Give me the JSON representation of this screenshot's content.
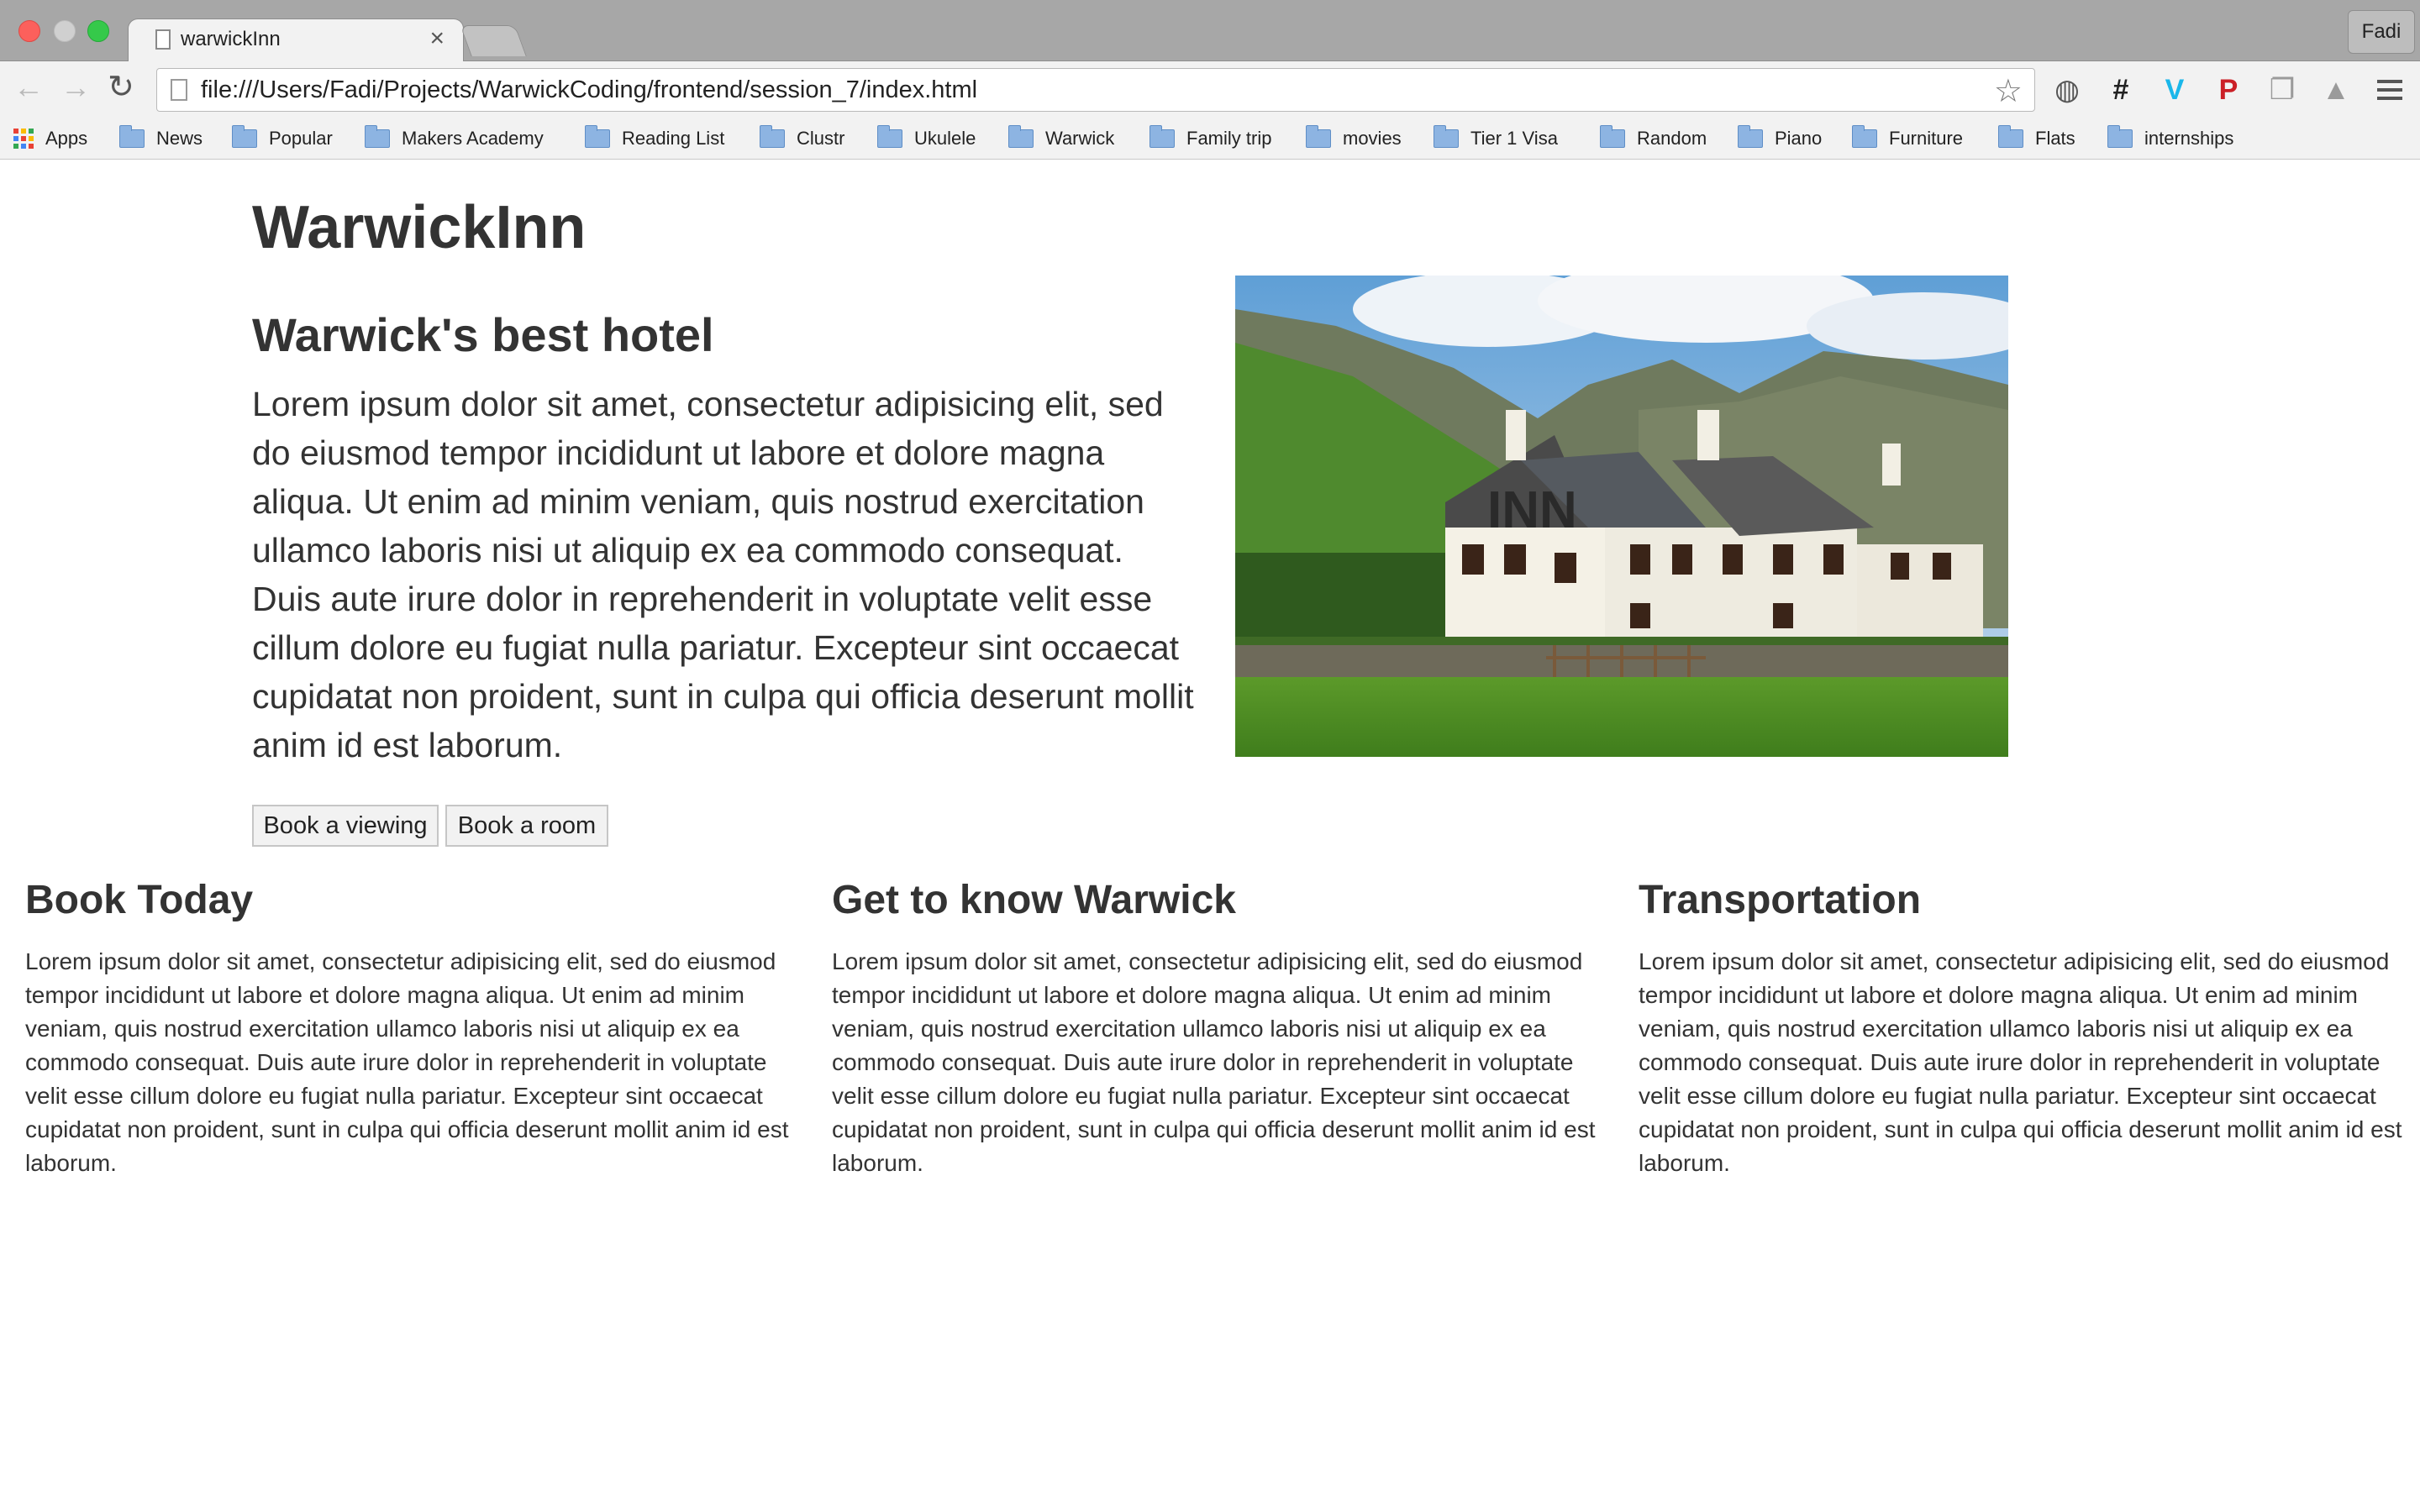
{
  "browser": {
    "tab_title": "warwickInn",
    "tab_close": "×",
    "profile_name": "Fadi",
    "url": "file:///Users/Fadi/Projects/WarwickCoding/frontend/session_7/index.html",
    "icons": {
      "back": "back-arrow-icon",
      "forward": "forward-arrow-icon",
      "reload": "reload-icon",
      "star": "bookmark-star-icon",
      "menu": "hamburger-menu-icon"
    },
    "extensions": [
      {
        "name": "ghostery-extension-icon",
        "glyph": "◍",
        "color": "#555555"
      },
      {
        "name": "hashtag-extension-icon",
        "glyph": "#",
        "color": "#222222"
      },
      {
        "name": "vimeo-extension-icon",
        "glyph": "V",
        "color": "#1ab7ea"
      },
      {
        "name": "pinterest-extension-icon",
        "glyph": "P",
        "color": "#cb2027"
      },
      {
        "name": "copy-extension-icon",
        "glyph": "❐",
        "color": "#9a9a9a"
      },
      {
        "name": "drive-extension-icon",
        "glyph": "▲",
        "color": "#9a9a9a"
      }
    ],
    "bookmarks": [
      "Apps",
      "News",
      "Popular",
      "Makers Academy",
      "Reading List",
      "Clustr",
      "Ukulele",
      "Warwick",
      "Family trip",
      "movies",
      "Tier 1 Visa",
      "Random",
      "Piano",
      "Furniture",
      "Flats",
      "internships"
    ]
  },
  "page": {
    "site_title": "WarwickInn",
    "hero": {
      "heading": "Warwick's best hotel",
      "text": "Lorem ipsum dolor sit amet, consectetur adipisicing elit, sed do eiusmod tempor incididunt ut labore et dolore magna aliqua. Ut enim ad minim veniam, quis nostrud exercitation ullamco laboris nisi ut aliquip ex ea commodo consequat. Duis aute irure dolor in reprehenderit in voluptate velit esse cillum dolore eu fugiat nulla pariatur. Excepteur sint occaecat cupidatat non proident, sunt in culpa qui officia deserunt mollit anim id est laborum.",
      "buttons": {
        "viewing": "Book a viewing",
        "room": "Book a room"
      },
      "image_sign": "INN"
    },
    "columns": [
      {
        "heading": "Book Today",
        "text": "Lorem ipsum dolor sit amet, consectetur adipisicing elit, sed do eiusmod tempor incididunt ut labore et dolore magna aliqua. Ut enim ad minim veniam, quis nostrud exercitation ullamco laboris nisi ut aliquip ex ea commodo consequat. Duis aute irure dolor in reprehenderit in voluptate velit esse cillum dolore eu fugiat nulla pariatur. Excepteur sint occaecat cupidatat non proident, sunt in culpa qui officia deserunt mollit anim id est laborum."
      },
      {
        "heading": "Get to know Warwick",
        "text": "Lorem ipsum dolor sit amet, consectetur adipisicing elit, sed do eiusmod tempor incididunt ut labore et dolore magna aliqua. Ut enim ad minim veniam, quis nostrud exercitation ullamco laboris nisi ut aliquip ex ea commodo consequat. Duis aute irure dolor in reprehenderit in voluptate velit esse cillum dolore eu fugiat nulla pariatur. Excepteur sint occaecat cupidatat non proident, sunt in culpa qui officia deserunt mollit anim id est laborum."
      },
      {
        "heading": "Transportation",
        "text": "Lorem ipsum dolor sit amet, consectetur adipisicing elit, sed do eiusmod tempor incididunt ut labore et dolore magna aliqua. Ut enim ad minim veniam, quis nostrud exercitation ullamco laboris nisi ut aliquip ex ea commodo consequat. Duis aute irure dolor in reprehenderit in voluptate velit esse cillum dolore eu fugiat nulla pariatur. Excepteur sint occaecat cupidatat non proident, sunt in culpa qui officia deserunt mollit anim id est laborum."
      }
    ]
  }
}
